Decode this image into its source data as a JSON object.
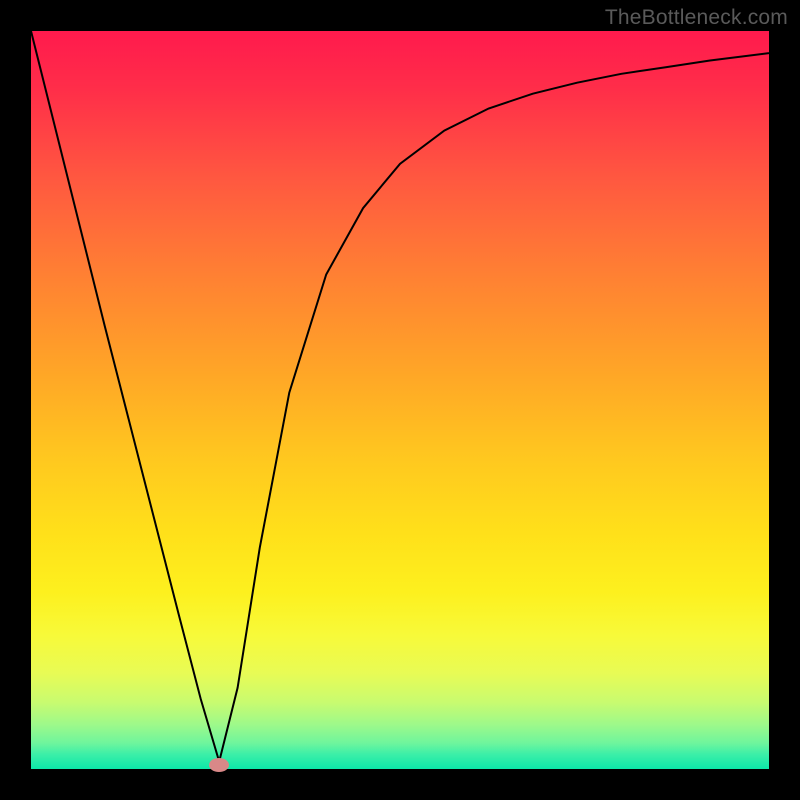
{
  "watermark": "TheBottleneck.com",
  "marker": {
    "x_frac": 0.255,
    "y_frac": 0.995
  },
  "chart_data": {
    "type": "line",
    "title": "",
    "xlabel": "",
    "ylabel": "",
    "xlim": [
      0,
      1
    ],
    "ylim": [
      0,
      1
    ],
    "series": [
      {
        "name": "bottleneck-curve",
        "x": [
          0.0,
          0.05,
          0.1,
          0.15,
          0.2,
          0.23,
          0.255,
          0.28,
          0.31,
          0.35,
          0.4,
          0.45,
          0.5,
          0.56,
          0.62,
          0.68,
          0.74,
          0.8,
          0.86,
          0.92,
          1.0
        ],
        "values": [
          1.0,
          0.8,
          0.6,
          0.405,
          0.21,
          0.095,
          0.01,
          0.11,
          0.3,
          0.51,
          0.67,
          0.76,
          0.82,
          0.865,
          0.895,
          0.915,
          0.93,
          0.942,
          0.951,
          0.96,
          0.97
        ]
      }
    ],
    "annotations": [
      {
        "type": "marker",
        "x": 0.255,
        "y": 0.005,
        "label": "optimal-point"
      }
    ],
    "background_gradient": {
      "top_color": "#ff1a4d",
      "bottom_color": "#0ce7a8"
    }
  }
}
